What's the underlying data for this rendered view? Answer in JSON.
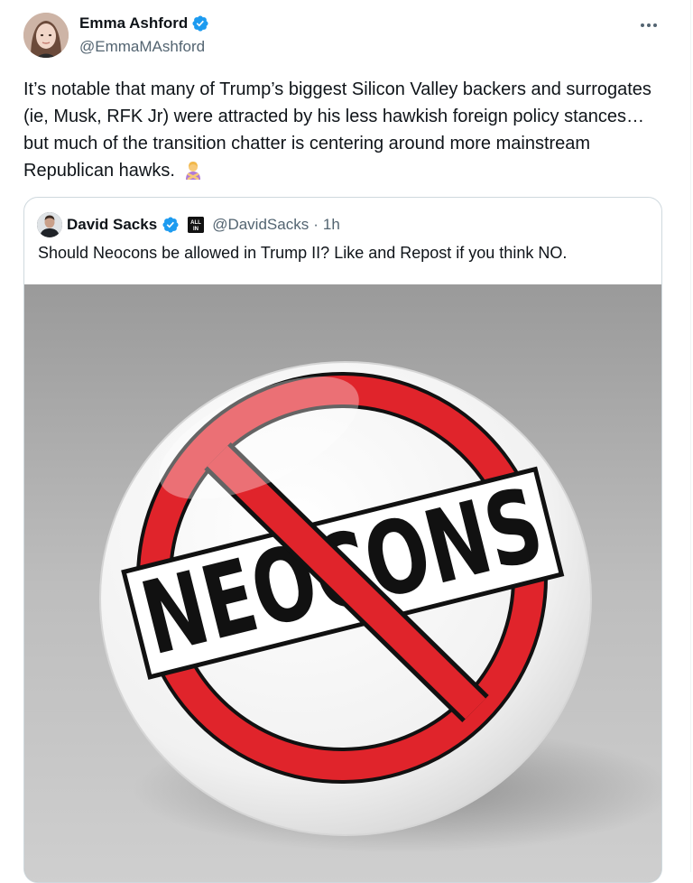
{
  "post": {
    "author": {
      "name": "Emma Ashford",
      "handle": "@EmmaMAshford",
      "verified": true
    },
    "text": "It’s notable that many of Trump’s biggest Silicon Valley backers and surrogates (ie, Musk, RFK Jr) were attracted by his less hawkish foreign policy stances… but much of the transition chatter is centering around more mainstream Republican hawks.",
    "emoji": "person-gesturing-no-emoji"
  },
  "quote": {
    "author": {
      "name": "David Sacks",
      "handle": "@DavidSacks",
      "verified": true,
      "affiliate_badge": "ALL IN"
    },
    "separator": "·",
    "time": "1h",
    "text": "Should Neocons be allowed in Trump II? Like and Repost if you think NO.",
    "image": {
      "button_text": "NEOCONS",
      "colors": {
        "ring": "#e0242b",
        "button": "#f4f4f4",
        "background": "#a6a6a6",
        "text": "#111111"
      }
    }
  },
  "colors": {
    "verified": "#1d9bf0",
    "secondary_text": "#536471"
  }
}
